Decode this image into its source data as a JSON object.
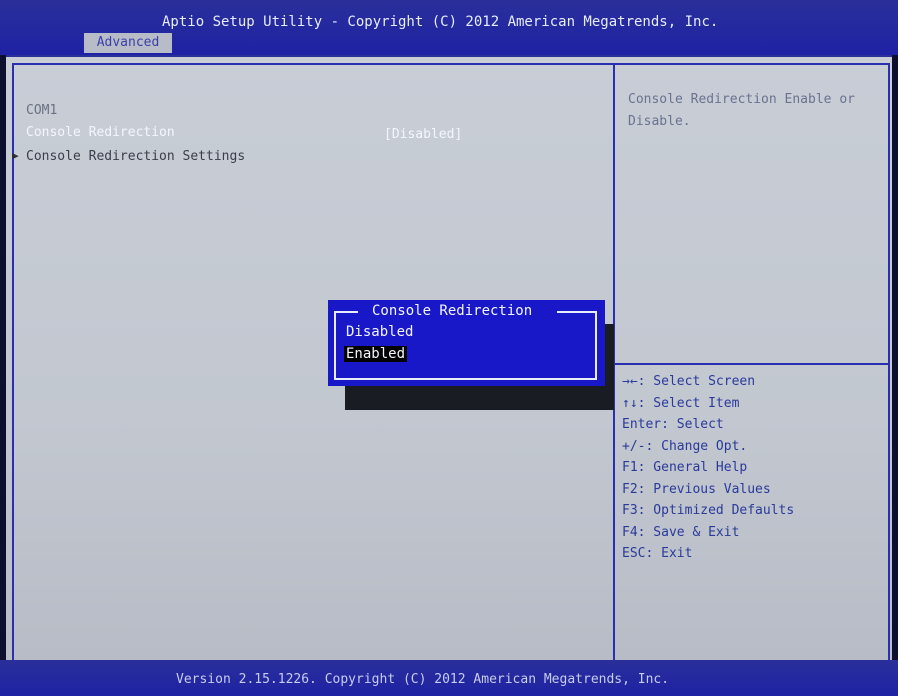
{
  "header": {
    "title": "Aptio Setup Utility - Copyright (C) 2012 American Megatrends, Inc.",
    "tab": "Advanced"
  },
  "main": {
    "section": "COM1",
    "items": [
      {
        "label": "Console Redirection",
        "value": "[Disabled]"
      },
      {
        "label": "Console Redirection Settings"
      }
    ],
    "submenu_arrow": "▶"
  },
  "help": {
    "text": "Console Redirection Enable or Disable."
  },
  "keys": [
    "→←: Select Screen",
    "↑↓: Select Item",
    "Enter: Select",
    "+/-: Change Opt.",
    "F1: General Help",
    "F2: Previous Values",
    "F3: Optimized Defaults",
    "F4: Save & Exit",
    "ESC: Exit"
  ],
  "popup": {
    "title": "Console Redirection",
    "options": [
      "Disabled",
      "Enabled"
    ],
    "selected": "Enabled"
  },
  "footer": {
    "text": "Version 2.15.1226. Copyright (C) 2012 American Megatrends, Inc."
  },
  "colors": {
    "bar_blue": "#1e22a4",
    "panel_gray": "#c2c7d0",
    "popup_blue": "#1818c8"
  }
}
